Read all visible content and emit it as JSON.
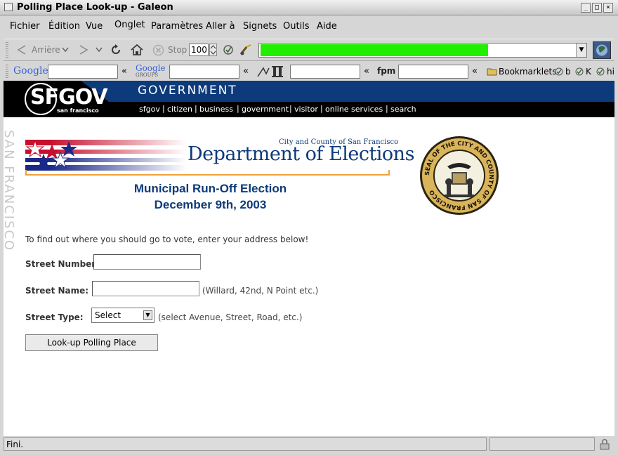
{
  "window": {
    "title": "Polling Place Look-up - Galeon",
    "btn_min": "_",
    "btn_max": "□",
    "btn_close": "×"
  },
  "menu": [
    {
      "label": "Fichier"
    },
    {
      "label": "Édition"
    },
    {
      "label": "Vue"
    },
    {
      "label": "Onglet"
    },
    {
      "label": "Paramètres"
    },
    {
      "label": "Aller à"
    },
    {
      "label": "Signets"
    },
    {
      "label": "Outils"
    },
    {
      "label": "Aide"
    }
  ],
  "toolbar": {
    "back_label": "Arrière",
    "stop_label": "Stop",
    "zoom_value": "100",
    "load_progress_percent": 72
  },
  "search_toolbar": {
    "chevron": "«",
    "bookmarklets_label": "Bookmarklets",
    "bm_b": "b",
    "bm_k": "K",
    "bm_hi": "hi",
    "google_label": "Google",
    "google_groups_label": "Google",
    "google_groups_sub": "GROUPS",
    "fpm_label": "fpm"
  },
  "sfgov": {
    "logo": "SFGOV",
    "logo_sub": "san francisco",
    "section": "GOVERNMENT",
    "nav": [
      "sfgov",
      "citizen",
      "business",
      "government",
      "visitor",
      "online services",
      "search"
    ],
    "separator": "|"
  },
  "sidebar_vertical": "SAN FRANCISCO",
  "department": {
    "small": "City and County of San Francisco",
    "title": "Department of Elections"
  },
  "election": {
    "name": "Municipal Run-Off Election",
    "date": "December 9th, 2003"
  },
  "seal_text": "SEAL OF THE CITY AND COUNTY OF SAN FRANCISCO",
  "form": {
    "intro": "To find out where you should go to vote, enter your address below!",
    "street_number_label": "Street Number:",
    "street_number_value": "",
    "street_name_label": "Street Name:",
    "street_name_value": "",
    "street_name_hint": "(Willard, 42nd, N Point etc.)",
    "street_type_label": "Street Type:",
    "street_type_value": "Select",
    "street_type_hint": "(select Avenue, Street, Road, etc.)",
    "submit_label": "Look-up Polling Place"
  },
  "status": {
    "text": "Fini."
  },
  "colors": {
    "navy": "#0d3a7a",
    "progress": "#22ee00",
    "orange_rule": "#f0a23a"
  }
}
